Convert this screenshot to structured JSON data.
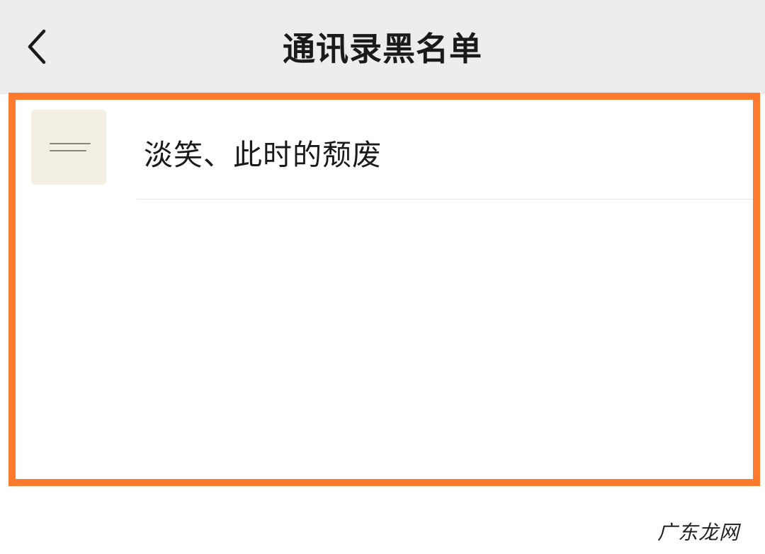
{
  "header": {
    "title": "通讯录黑名单",
    "back_icon": "chevron-left-icon"
  },
  "blacklist": {
    "items": [
      {
        "name": "淡笑、此时的颓废",
        "avatar": "avatar-image"
      }
    ]
  },
  "highlight": {
    "color": "#fd7a2e"
  },
  "watermark": {
    "text": "广东龙网"
  }
}
